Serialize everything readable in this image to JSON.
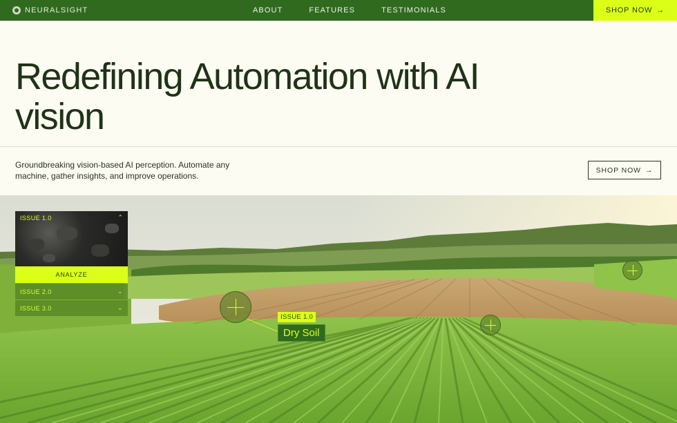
{
  "nav": {
    "brand": "NEURALSIGHT",
    "links": [
      "ABOUT",
      "FEATURES",
      "TESTIMONIALS"
    ],
    "shop_label": "SHOP NOW",
    "arrow": "→"
  },
  "hero": {
    "headline": "Redefining Automation with AI vision",
    "subtext": "Groundbreaking vision-based AI perception. Automate any machine, gather insights, and improve operations.",
    "shop_label": "SHOP NOW",
    "arrow": "→"
  },
  "panel": {
    "active_issue": "ISSUE 1.0",
    "analyze_label": "ANALYZE",
    "issues": [
      "ISSUE 2.0",
      "ISSUE 3.0"
    ],
    "chevron_up": "⌃",
    "chevron_down": "⌄"
  },
  "annotation": {
    "tag": "ISSUE 1.0",
    "label": "Dry Soil"
  },
  "colors": {
    "nav_green": "#2f6a1f",
    "accent_lime": "#dcff17",
    "headline": "#1f3317",
    "background": "#fdfcf2"
  }
}
